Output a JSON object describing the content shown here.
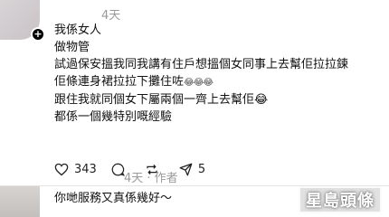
{
  "comment": {
    "timestamp": "4天",
    "lines": [
      "我係女人",
      "做物管",
      "試過保安搵我同我講有住戶想搵個女同事上去幫佢拉拉鍊",
      "佢條連身裙拉拉下攤住咗",
      "跟住我就同個女下屬兩個一齊上去幫佢",
      "都係一個幾特別嘅經驗"
    ],
    "line4_tail": "😂😂😂",
    "line5_emoji": "😂",
    "likes": "343",
    "reposts": "5"
  },
  "reply": {
    "meta": "4天 · 作者",
    "text": "你哋服務又真係幾好～"
  },
  "watermark": "星島頭條"
}
